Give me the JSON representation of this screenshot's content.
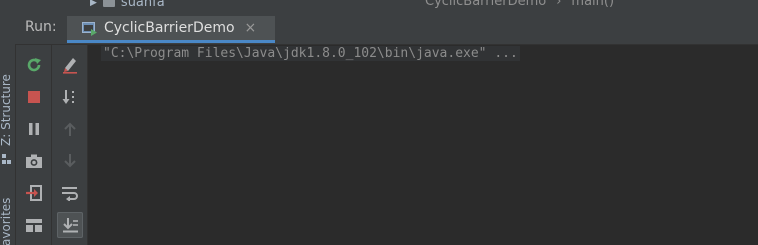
{
  "side": {
    "structure_label": "Z: Structure",
    "favorites_label": "avorites"
  },
  "top": {
    "tree_item": "suanfa",
    "breadcrumb_class": "CyclicBarrierDemo",
    "breadcrumb_sep": "›",
    "breadcrumb_method": "main()"
  },
  "run": {
    "label": "Run:",
    "tab_title": "CyclicBarrierDemo",
    "close_glyph": "×"
  },
  "toolbar": {
    "left": [
      "rerun-icon",
      "stop-icon",
      "pause-icon",
      "camera-icon",
      "exit-icon",
      "layout-icon"
    ],
    "right": [
      "clear-icon",
      "sort-icon",
      "up-arrow-icon",
      "down-arrow-icon",
      "soft-wrap-icon",
      "scroll-to-end-icon"
    ]
  },
  "console": {
    "line1": "\"C:\\Program Files\\Java\\jdk1.8.0_102\\bin\\java.exe\" ..."
  },
  "colors": {
    "background": "#2b2b2b",
    "panel": "#3c3f41",
    "tab_active": "#4e5254",
    "accent_blue": "#4a88c7",
    "green": "#59a869",
    "red": "#c75450",
    "text": "#a9b7c6",
    "console_text": "#8c8c8c"
  }
}
